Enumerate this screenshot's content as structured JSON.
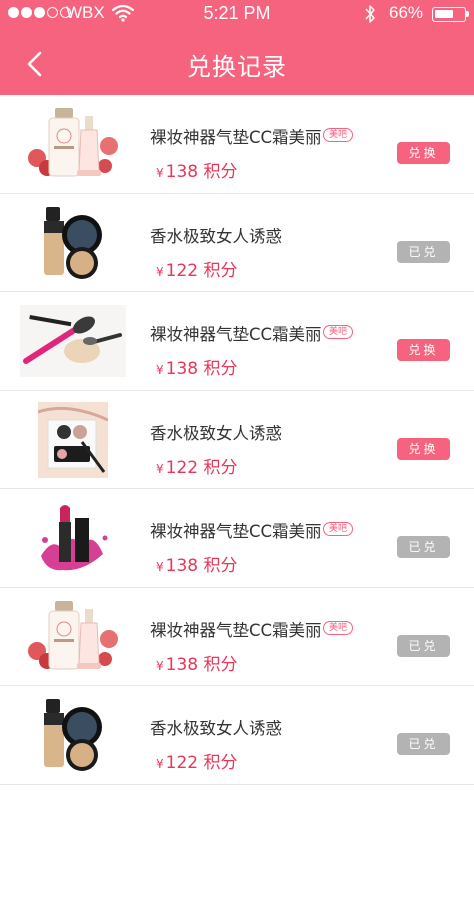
{
  "status_bar": {
    "carrier": "WBX",
    "time": "5:21 PM",
    "battery": "66%",
    "battery_level": 0.66
  },
  "nav": {
    "title": "兑换记录"
  },
  "colors": {
    "brand": "#f6637e",
    "price": "#e8375a",
    "disabled": "#b3b3b3"
  },
  "items": [
    {
      "title": "裸妆神器气垫CC霜美丽",
      "tag": "美吧",
      "currency": "¥",
      "price": "138 积分",
      "button": "兑换",
      "status": "exchange",
      "image": "perfume-bottle-image"
    },
    {
      "title": "香水极致女人诱惑",
      "tag": "",
      "currency": "¥",
      "price": "122 积分",
      "button": "已兑",
      "status": "done",
      "image": "foundation-compact-image"
    },
    {
      "title": "裸妆神器气垫CC霜美丽",
      "tag": "美吧",
      "currency": "¥",
      "price": "138 积分",
      "button": "兑换",
      "status": "exchange",
      "image": "makeup-brush-image"
    },
    {
      "title": "香水极致女人诱惑",
      "tag": "",
      "currency": "¥",
      "price": "122 积分",
      "button": "兑换",
      "status": "exchange",
      "image": "eyeshadow-palette-image"
    },
    {
      "title": "裸妆神器气垫CC霜美丽",
      "tag": "美吧",
      "currency": "¥",
      "price": "138 积分",
      "button": "已兑",
      "status": "done",
      "image": "lipstick-splash-image"
    },
    {
      "title": "裸妆神器气垫CC霜美丽",
      "tag": "美吧",
      "currency": "¥",
      "price": "138 积分",
      "button": "已兑",
      "status": "done",
      "image": "perfume-bottle-image"
    },
    {
      "title": "香水极致女人诱惑",
      "tag": "",
      "currency": "¥",
      "price": "122 积分",
      "button": "已兑",
      "status": "done",
      "image": "foundation-compact-image"
    }
  ]
}
